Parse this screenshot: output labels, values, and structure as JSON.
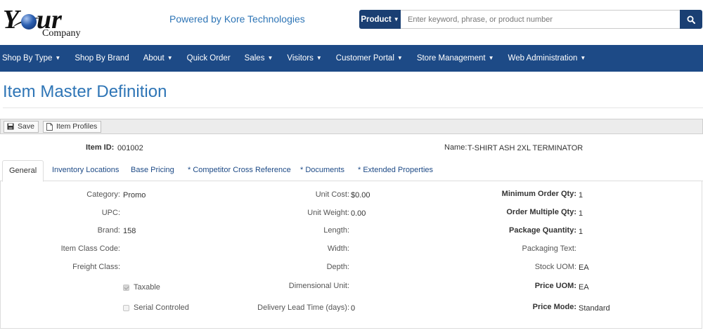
{
  "header": {
    "logo": {
      "part1": "Y",
      "part2": "ur",
      "company": "Company"
    },
    "powered_by": "Powered by Kore Technologies",
    "search": {
      "category": "Product",
      "placeholder": "Enter keyword, phrase, or product number",
      "value": "",
      "button_icon": "search-icon"
    }
  },
  "nav": {
    "items": [
      {
        "label": "Shop By Type",
        "dropdown": true
      },
      {
        "label": "Shop By Brand",
        "dropdown": false
      },
      {
        "label": "About",
        "dropdown": true
      },
      {
        "label": "Quick Order",
        "dropdown": false
      },
      {
        "label": "Sales",
        "dropdown": true
      },
      {
        "label": "Visitors",
        "dropdown": true
      },
      {
        "label": "Customer Portal",
        "dropdown": true
      },
      {
        "label": "Store Management",
        "dropdown": true
      },
      {
        "label": "Web Administration",
        "dropdown": true
      }
    ]
  },
  "page": {
    "title": "Item Master Definition"
  },
  "toolbar": {
    "save_label": "Save",
    "save_icon": "floppy-disk-icon",
    "profiles_label": "Item Profiles",
    "profiles_icon": "document-icon"
  },
  "item": {
    "id_label": "Item ID:",
    "id_value": "001002",
    "name_label": "Name:",
    "name_value": "T-SHIRT ASH 2XL TERMINATOR"
  },
  "tabs": [
    {
      "label": "General",
      "active": true
    },
    {
      "label": "Inventory Locations",
      "active": false
    },
    {
      "label": "Base Pricing",
      "active": false
    },
    {
      "label": "* Competitor Cross Reference",
      "active": false
    },
    {
      "label": "* Documents",
      "active": false
    },
    {
      "label": "* Extended Properties",
      "active": false
    }
  ],
  "general": {
    "col1": {
      "category": {
        "label": "Category:",
        "value": "Promo"
      },
      "upc": {
        "label": "UPC:",
        "value": ""
      },
      "brand": {
        "label": "Brand:",
        "value": "158"
      },
      "item_class": {
        "label": "Item Class Code:",
        "value": ""
      },
      "freight": {
        "label": "Freight Class:",
        "value": ""
      },
      "taxable": {
        "label": "Taxable",
        "checked": true
      },
      "serial": {
        "label": "Serial Controled",
        "checked": false
      }
    },
    "col2": {
      "unit_cost": {
        "label": "Unit Cost:",
        "value": "$0.00"
      },
      "unit_weight": {
        "label": "Unit Weight:",
        "value": "0.00"
      },
      "length": {
        "label": "Length:",
        "value": ""
      },
      "width": {
        "label": "Width:",
        "value": ""
      },
      "depth": {
        "label": "Depth:",
        "value": ""
      },
      "dim_unit": {
        "label": "Dimensional Unit:",
        "value": ""
      },
      "lead_time": {
        "label": "Delivery Lead Time (days):",
        "value": "0"
      }
    },
    "col3": {
      "min_order": {
        "label": "Minimum Order Qty:",
        "value": "1"
      },
      "order_multiple": {
        "label": "Order Multiple Qty:",
        "value": "1"
      },
      "package_qty": {
        "label": "Package Quantity:",
        "value": "1"
      },
      "packaging_text": {
        "label": "Packaging Text:",
        "value": ""
      },
      "stock_uom": {
        "label": "Stock UOM:",
        "value": "EA"
      },
      "price_uom": {
        "label": "Price UOM:",
        "value": "EA"
      },
      "price_mode": {
        "label": "Price Mode:",
        "value": "Standard"
      }
    }
  },
  "colors": {
    "brand_blue": "#1d4a86",
    "link_blue": "#2e75b6",
    "search_blue": "#1a3f73"
  }
}
